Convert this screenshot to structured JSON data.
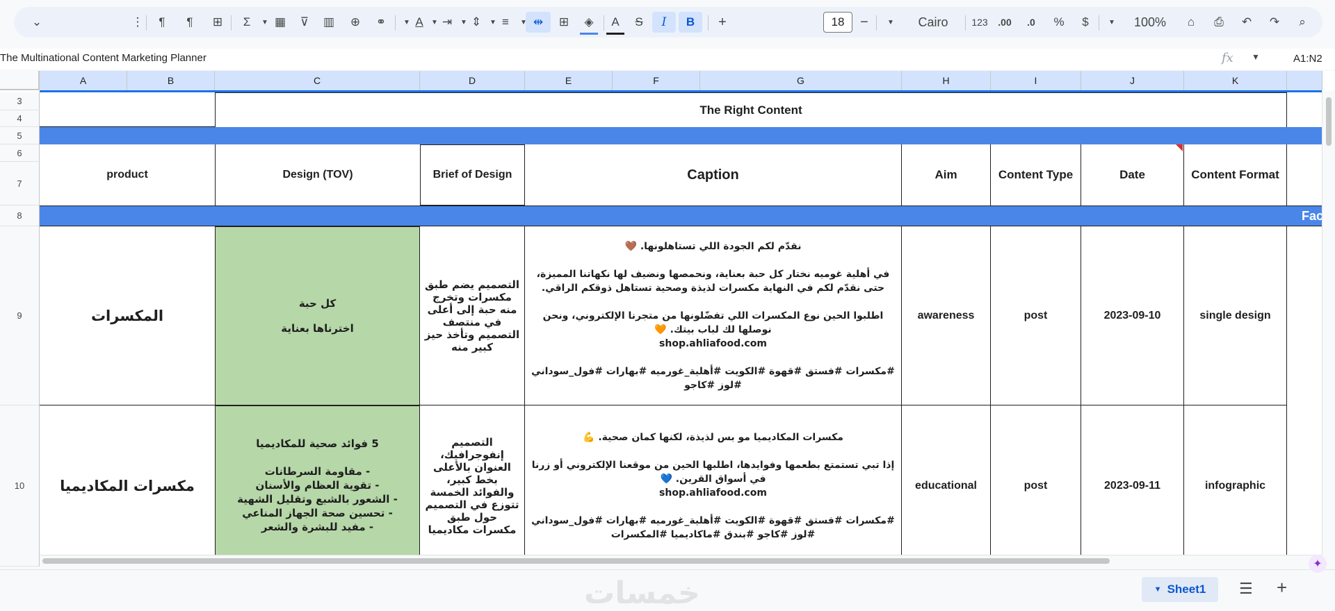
{
  "toolbar": {
    "font_name": "Cairo",
    "font_size": "18",
    "number_format": "123",
    "decimal_increase": ".00",
    "decimal_decrease": ".0",
    "percent": "%",
    "currency": "$",
    "zoom": "100%",
    "format_painter": "A"
  },
  "formula_bar": {
    "content": "The Multinational Content Marketing Planner",
    "range": "A1:N2"
  },
  "columns": [
    "A",
    "B",
    "C",
    "D",
    "E",
    "F",
    "G",
    "H",
    "I",
    "J",
    "K"
  ],
  "rows": [
    "3",
    "4",
    "5",
    "6",
    "7",
    "8",
    "9",
    "10"
  ],
  "sheet": {
    "title_banner": "The Right Content",
    "headers": {
      "product": "product",
      "design": "Design (TOV)",
      "brief": "Brief of Design",
      "caption": "Caption",
      "aim": "Aim",
      "content_type": "Content Type",
      "date": "Date",
      "content_format": "Content Format"
    },
    "section_label": "Fac",
    "rows": [
      {
        "product": "المكسرات",
        "design": "كل حبة\n\nاخترناها بعناية",
        "brief": "التصميم يضم طبق مكسرات وتخرج منه حبة إلى أعلى في منتصف التصميم وتأخذ حيز كبير منه",
        "caption": "نقدّم لكم الجودة اللي تستاهلونها. 🤎\n\nفي أهلية غوميه نختار كل حبة بعناية، ونحمصها ونضيف لها نكهاتنا المميزة، حتى نقدّم لكم في النهاية مكسرات لذيذة وصحية تستاهل ذوقكم الراقي.\n\nاطلبوا الحين نوع المكسرات اللي تفضّلونها من متجرنا الإلكتروني، ونحن نوصلها لك لباب بيتك. 🧡\nshop.ahliafood.com\n\n#مكسرات #فستق #قهوة #الكويت #أهلية_غورميه #بهارات #فول_سوداني #لوز #كاجو",
        "aim": "awareness",
        "content_type": "post",
        "date": "2023-09-10",
        "content_format": "single design"
      },
      {
        "product": "مكسرات المكاديميا",
        "design": "5 فوائد صحية للمكاديميا\n\n- مقاومة السرطانات\n- تقوية العظام والأسنان\n- الشعور بالشبع وتقليل الشهية\n- تحسين صحة الجهاز المناعي\n- مفيد للبشرة والشعر",
        "brief": "التصميم إنفوجرافيك، العنوان بالأعلى بخط كبير، والفوائد الخمسة تتوزع في التصميم حول طبق مكسرات مكاديميا",
        "caption": "مكسرات المكاديميا مو بس لذيذة، لكنها كمان صحية. 💪\n\nإذا تبي تستمتع بطعمها وفوايدها، اطلبها الحين من موقعنا الإلكتروني أو زرنا في أسواق القرين. 💙\nshop.ahliafood.com\n\n#مكسرات #فستق #قهوة #الكويت #أهلية_غورميه #بهارات #فول_سوداني #لوز #كاجو #بندق #ماكاديميا #المكسرات",
        "aim": "educational",
        "content_type": "post",
        "date": "2023-09-11",
        "content_format": "infographic"
      }
    ]
  },
  "sheet_tab": "Sheet1",
  "watermark": "خمسات",
  "colors": {
    "blue_band": "#4a86e8",
    "green_cell": "#b6d7a8",
    "toolbar_bg": "#edf2fa",
    "column_header": "#d3e3fd",
    "active_tab": "#0b57d0"
  }
}
